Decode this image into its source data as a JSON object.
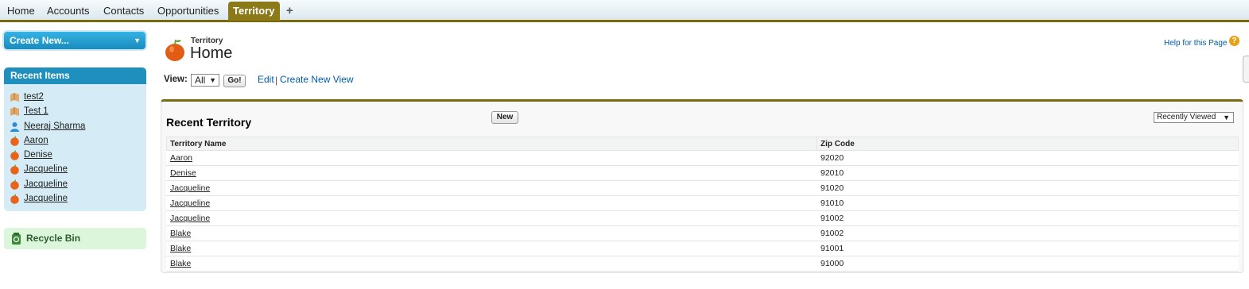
{
  "tabs": [
    {
      "label": "Home",
      "active": false
    },
    {
      "label": "Accounts",
      "active": false
    },
    {
      "label": "Contacts",
      "active": false
    },
    {
      "label": "Opportunities",
      "active": false
    },
    {
      "label": "Territory",
      "active": true
    },
    {
      "label": "+",
      "active": false
    }
  ],
  "sidebar": {
    "create_new": "Create New...",
    "recent_title": "Recent Items",
    "recent_items": [
      {
        "label": "test2",
        "icon": "book-icon"
      },
      {
        "label": "Test 1",
        "icon": "book-icon"
      },
      {
        "label": "Neeraj Sharma",
        "icon": "person-icon"
      },
      {
        "label": "Aaron",
        "icon": "apple-icon"
      },
      {
        "label": "Denise",
        "icon": "apple-icon"
      },
      {
        "label": "Jacqueline",
        "icon": "apple-icon"
      },
      {
        "label": "Jacqueline",
        "icon": "apple-icon"
      },
      {
        "label": "Jacqueline",
        "icon": "apple-icon"
      }
    ],
    "recycle_bin": "Recycle Bin"
  },
  "header": {
    "object": "Territory",
    "title": "Home",
    "help": "Help for this Page",
    "help_icon": "?"
  },
  "view": {
    "label": "View:",
    "selected": "All",
    "go": "Go!",
    "edit": "Edit",
    "separator": "|",
    "create_new_view": "Create New View"
  },
  "recent": {
    "title": "Recent Territory",
    "new_button": "New",
    "filter": "Recently Viewed",
    "columns": [
      "Territory Name",
      "Zip Code"
    ],
    "rows": [
      {
        "name": "Aaron",
        "zip": "92020"
      },
      {
        "name": "Denise",
        "zip": "92010"
      },
      {
        "name": "Jacqueline",
        "zip": "91020"
      },
      {
        "name": "Jacqueline",
        "zip": "91010"
      },
      {
        "name": "Jacqueline",
        "zip": "91002"
      },
      {
        "name": "Blake",
        "zip": "91002"
      },
      {
        "name": "Blake",
        "zip": "91001"
      },
      {
        "name": "Blake",
        "zip": "91000"
      }
    ]
  },
  "colors": {
    "accent": "#7a6a0e",
    "active_tab": "#8c7a18",
    "sidebar_blue": "#1f8fbe",
    "link": "#015ba7"
  }
}
